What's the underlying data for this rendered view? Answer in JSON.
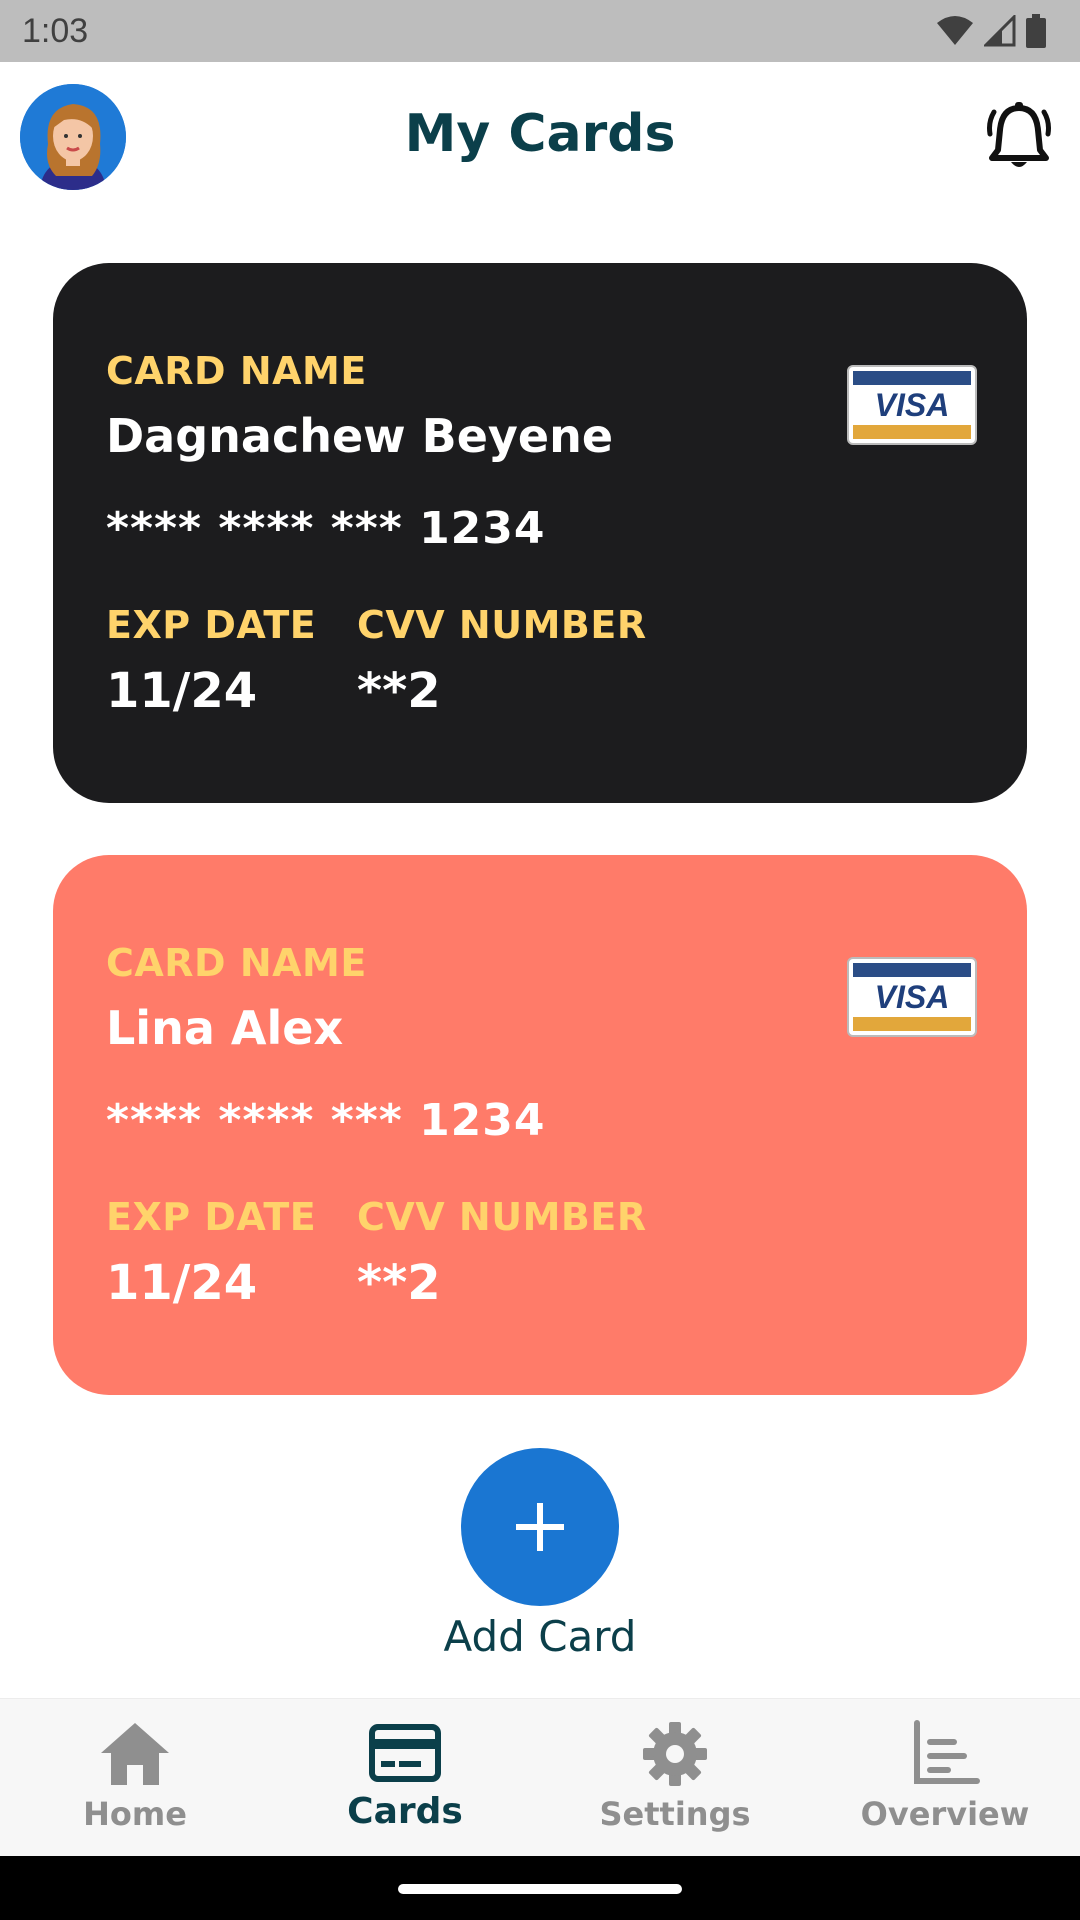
{
  "status": {
    "time": "1:03"
  },
  "header": {
    "title": "My Cards"
  },
  "cards": [
    {
      "name_label": "CARD NAME",
      "name": "Dagnachew Beyene",
      "number": "**** **** *** 1234",
      "exp_label": "EXP DATE",
      "exp": "11/24",
      "cvv_label": "CVV NUMBER",
      "cvv": "**2",
      "brand": "VISA",
      "color": "#1c1c1e"
    },
    {
      "name_label": "CARD NAME",
      "name": "Lina Alex",
      "number": "**** **** *** 1234",
      "exp_label": "EXP DATE",
      "exp": "11/24",
      "cvv_label": "CVV NUMBER",
      "cvv": "**2",
      "brand": "VISA",
      "color": "#ff7b69"
    }
  ],
  "add_card": {
    "label": "Add Card"
  },
  "nav": {
    "items": [
      {
        "label": "Home",
        "icon": "home-icon"
      },
      {
        "label": "Cards",
        "icon": "card-icon",
        "active": true
      },
      {
        "label": "Settings",
        "icon": "gear-icon"
      },
      {
        "label": "Overview",
        "icon": "chart-icon"
      }
    ]
  },
  "colors": {
    "accent": "#1a76d2",
    "label_yellow": "#ffd36b",
    "title": "#0b3f4a"
  }
}
